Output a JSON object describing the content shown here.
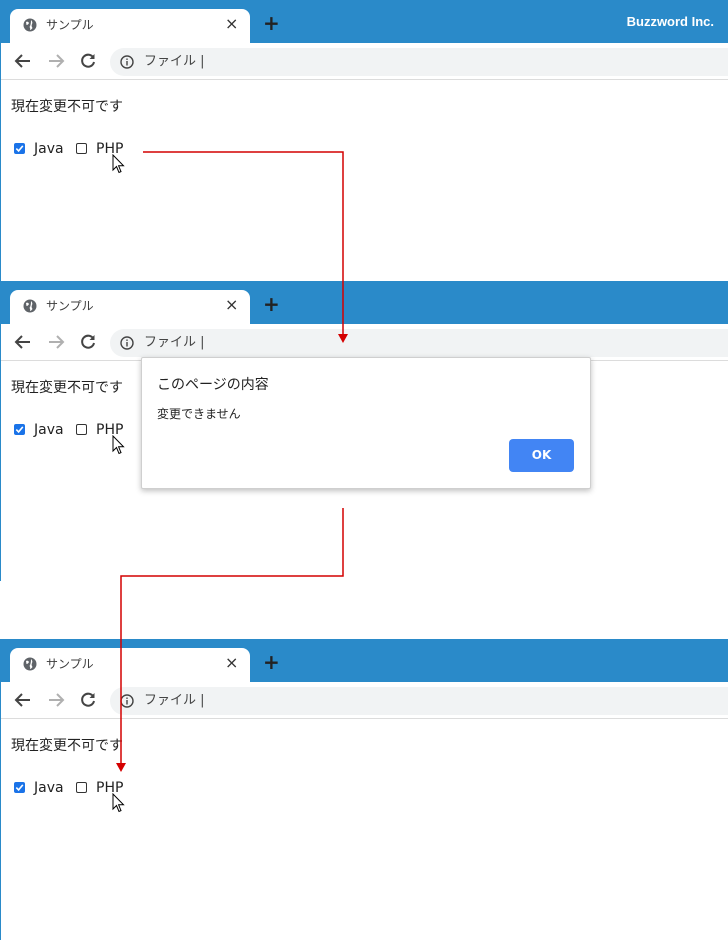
{
  "browser": {
    "tab_title": "サンプル",
    "tab_close": "×",
    "new_tab": "+",
    "brand": "Buzzword Inc.",
    "address": "ファイル |"
  },
  "page": {
    "status_text": "現在変更不可です",
    "checkboxes": [
      {
        "label": "Java",
        "checked": true
      },
      {
        "label": "PHP",
        "checked": false
      }
    ]
  },
  "dialog": {
    "title": "このページの内容",
    "message": "変更できません",
    "ok_label": "OK"
  },
  "colors": {
    "titlebar": "#2a8ac9",
    "arrow": "#d40000",
    "ok_button": "#4285f4",
    "checkbox": "#1a73e8"
  }
}
